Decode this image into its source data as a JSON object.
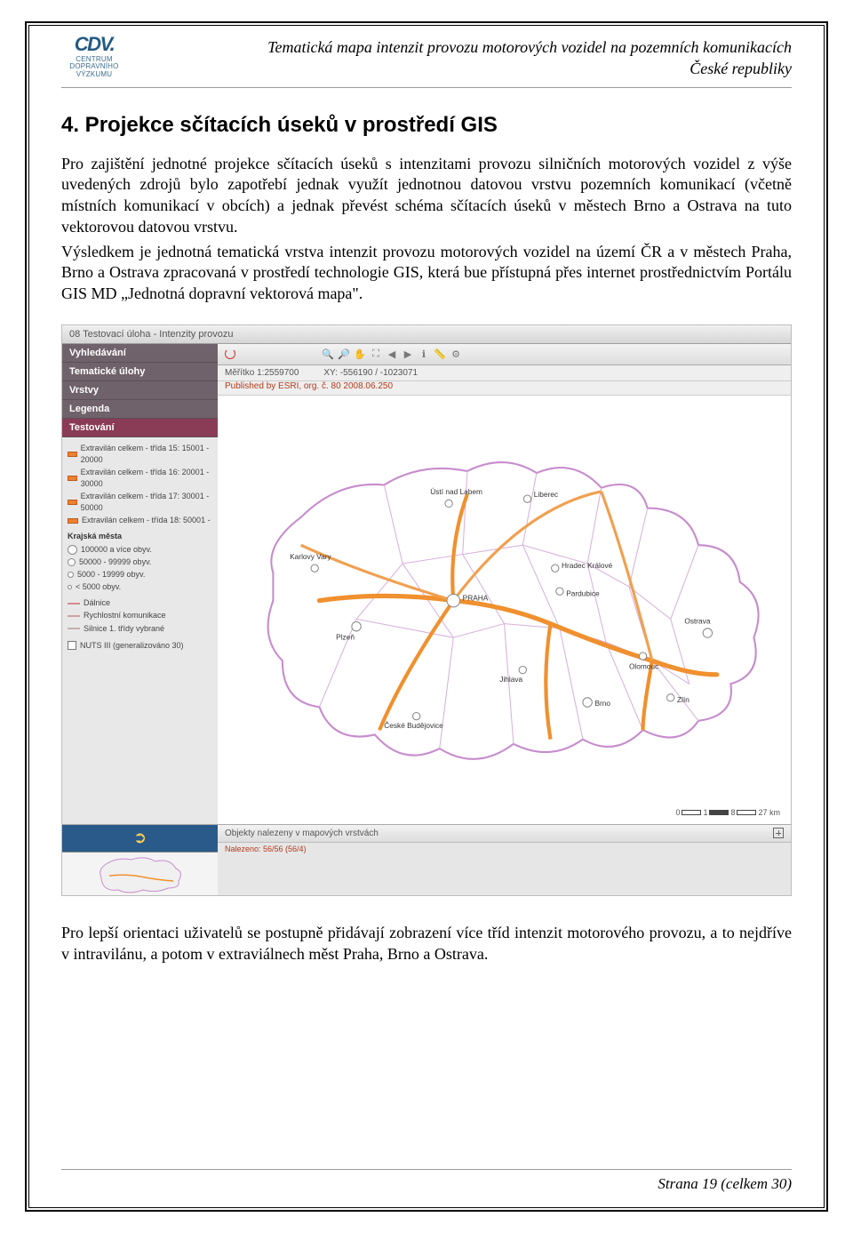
{
  "header": {
    "logo_text": "CDV.",
    "logo_caption_l1": "CENTRUM",
    "logo_caption_l2": "DOPRAVNÍHO",
    "logo_caption_l3": "VÝZKUMU",
    "title_l1": "Tematická mapa intenzit provozu motorových vozidel na pozemních komunikacích",
    "title_l2": "České republiky"
  },
  "section": {
    "heading": "4. Projekce sčítacích úseků v prostředí GIS",
    "para1": "Pro zajištění jednotné projekce sčítacích úseků s intenzitami provozu silničních motorových vozidel z výše uvedených zdrojů bylo zapotřebí jednak využít jednotnou datovou vrstvu pozemních komunikací (včetně místních komunikací v obcích) a jednak převést schéma sčítacích úseků v městech Brno a Ostrava na tuto vektorovou datovou vrstvu.",
    "para2": "Výsledkem je jednotná tematická vrstva intenzit provozu motorových vozidel na území ČR a v městech Praha, Brno a Ostrava zpracovaná v prostředí technologie GIS, která bue přístupná přes internet prostřednictvím Portálu GIS MD „Jednotná dopravní vektorová mapa\".",
    "para3": "Pro lepší orientaci uživatelů se postupně přidávají zobrazení více tříd intenzit motorového provozu, a to nejdříve v intravilánu, a potom v extraviálnech měst Praha, Brno a Ostrava."
  },
  "gis": {
    "window_title": "08 Testovací úloha - Intenzity provozu",
    "nav": {
      "item1": "Vyhledávání",
      "item2": "Tematické úlohy",
      "item3": "Vrstvy",
      "item4": "Legenda",
      "item5": "Testování"
    },
    "legend": {
      "l1": "Extravilán celkem - třída 15: 15001 - 20000",
      "l2": "Extravilán celkem - třída 16: 20001 - 30000",
      "l3": "Extravilán celkem - třída 17: 30001 - 50000",
      "l4": "Extravilán celkem - třída 18: 50001 -",
      "head_mesta": "Krajská města",
      "c1": "100000 a více obyv.",
      "c2": "50000 - 99999 obyv.",
      "c3": "5000 - 19999 obyv.",
      "c4": "< 5000 obyv.",
      "t1": "Dálnice",
      "t2": "Rychlostní komunikace",
      "t3": "Silnice 1. třídy vybrané",
      "chk": "NUTS III (generalizováno 30)"
    },
    "infobar": {
      "scale": "Měřítko 1:2559700",
      "coords": "XY: -556190 / -1023071"
    },
    "published": "Published by ESRI, org. č. 80 2008.06.250",
    "map_cities": {
      "praha": "PRAHA",
      "brno": "Brno",
      "ostrava": "Ostrava",
      "plzen": "Plzeň",
      "kv": "Karlovy Vary",
      "ul": "Ústí nad Labem",
      "lb": "Liberec",
      "hk": "Hradec Králové",
      "pa": "Pardubice",
      "ji": "Jihlava",
      "cb": "České Budějovice",
      "ol": "Olomouc",
      "zl": "Zlín"
    },
    "scalebar": {
      "v0": "0",
      "v1": "1",
      "v2": "8",
      "v3": "27 km"
    },
    "footer_row": {
      "title": "Objekty nalezeny v mapových vrstvách",
      "sub": "Nalezeno: 56/56 (56/4)"
    }
  },
  "footer": {
    "page": "Strana 19 (celkem 30)"
  }
}
